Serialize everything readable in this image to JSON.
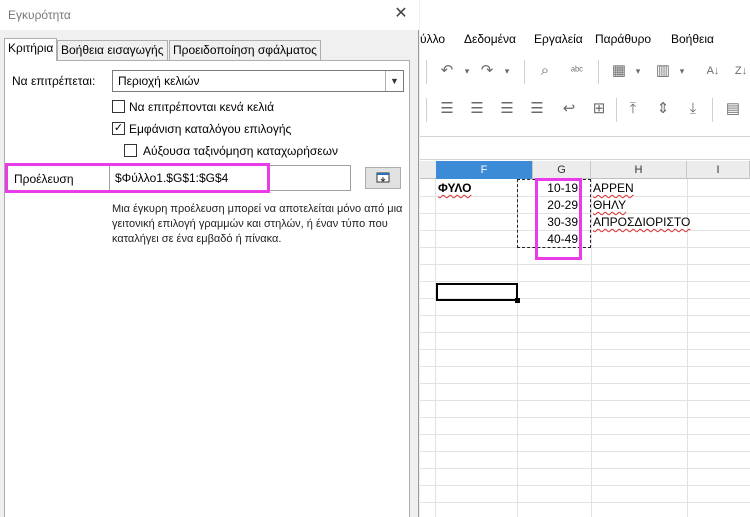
{
  "dialog": {
    "title": "Εγκυρότητα",
    "tabs": [
      "Κριτήρια",
      "Βοήθεια εισαγωγής",
      "Προειδοποίηση σφάλματος"
    ],
    "allow_label": "Να επιτρέπεται:",
    "allow_value": "Περιοχή κελιών",
    "allow_blank_label": "Να επιτρέπονται κενά κελιά",
    "allow_blank_checked": false,
    "show_list_label": "Εμφάνιση καταλόγου επιλογής",
    "show_list_checked": true,
    "sort_label": "Αύξουσα ταξινόμηση καταχωρήσεων",
    "sort_checked": false,
    "source_label": "Προέλευση",
    "source_value": "$Φύλλο1.$G$1:$G$4",
    "help_text": "Μια έγκυρη προέλευση μπορεί να αποτελείται μόνο από μια γειτονική επιλογή γραμμών και στηλών, ή έναν τύπο που καταλήγει σε ένα εμβαδό ή πίνακα."
  },
  "menu": [
    "ύλλο",
    "Δεδομένα",
    "Εργαλεία",
    "Παράθυρο",
    "Βοήθεια"
  ],
  "sheet": {
    "columns": [
      "F",
      "G",
      "H",
      "I"
    ],
    "active_column": "F",
    "f1": "ΦΥΛΟ",
    "g_values": [
      "10-19",
      "20-29",
      "30-39",
      "40-49"
    ],
    "h_values": [
      "ΑΡΡΕΝ",
      "ΘΗΛΥ",
      "ΑΠΡΟΣΔΙΟΡΙΣΤΟ"
    ]
  },
  "colors": {
    "highlight": "#e83ce8",
    "active_column_header": "#3c8bd6",
    "spellcheck_underline": "#e03030"
  }
}
